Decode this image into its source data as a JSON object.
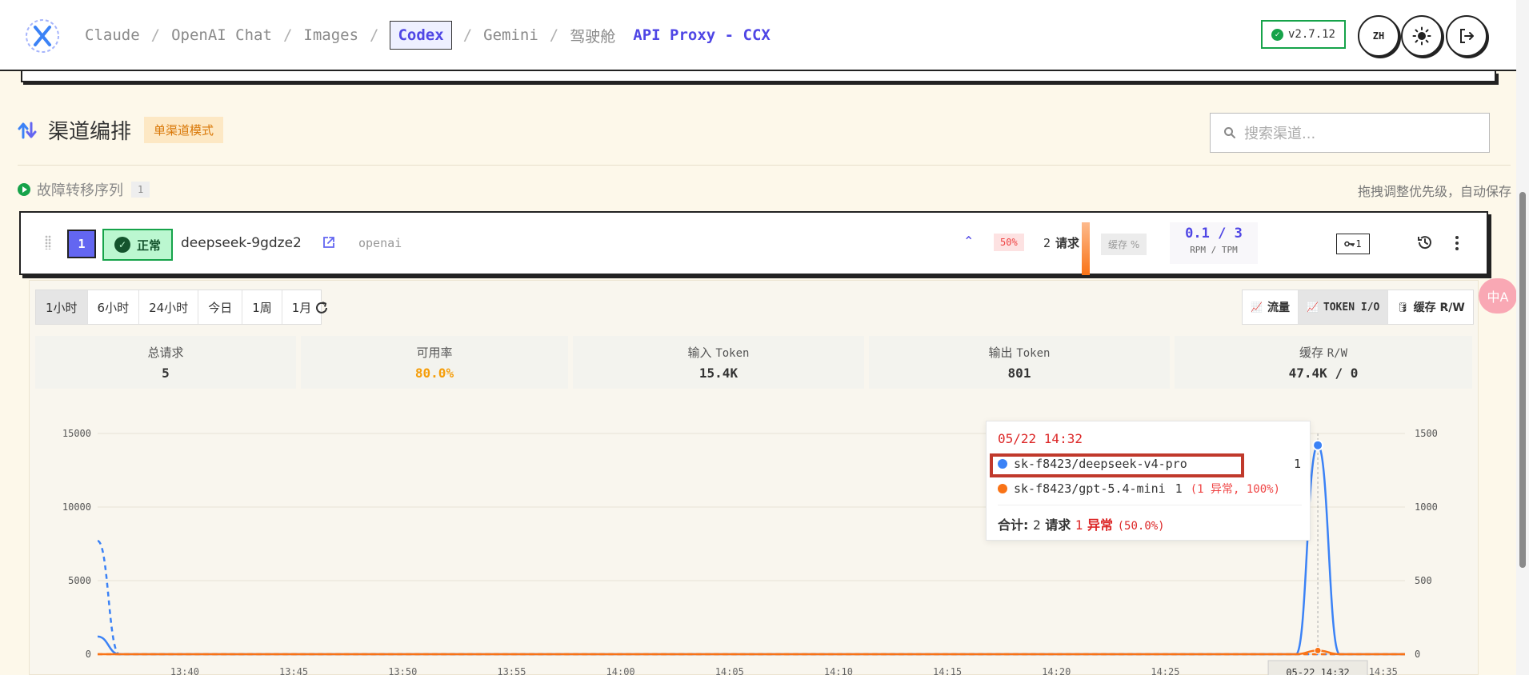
{
  "header": {
    "nav": [
      {
        "label": "Claude",
        "active": false
      },
      {
        "label": "OpenAI Chat",
        "active": false
      },
      {
        "label": "Images",
        "active": false
      },
      {
        "label": "Codex",
        "active": true
      },
      {
        "label": "Gemini",
        "active": false
      },
      {
        "label": "驾驶舱",
        "active": false
      }
    ],
    "brand": "API Proxy - CCX",
    "version": "v2.7.12",
    "lang": "ZH"
  },
  "section": {
    "title": "渠道编排",
    "mode_badge": "单渠道模式",
    "search_placeholder": "搜索渠道...",
    "failover_label": "故障转移序列",
    "failover_count": "1",
    "drag_hint": "拖拽调整优先级，自动保存"
  },
  "channel": {
    "index": "1",
    "status": "正常",
    "name": "deepseek-9gdze2",
    "type": "openai",
    "error_rate": "50%",
    "requests_count": "2",
    "requests_label": "请求",
    "cache_label": "缓存 %",
    "rate_value": "0.1 / 3",
    "rate_label": "RPM / TPM",
    "keys_count": "1"
  },
  "ranges": [
    {
      "label": "1小时",
      "active": true
    },
    {
      "label": "6小时",
      "active": false
    },
    {
      "label": "24小时",
      "active": false
    },
    {
      "label": "今日",
      "active": false
    },
    {
      "label": "1周",
      "active": false
    },
    {
      "label": "1月",
      "active": false
    }
  ],
  "metric_tabs": [
    {
      "label": "流量",
      "active": false
    },
    {
      "label": "TOKEN I/O",
      "active": true
    },
    {
      "label": "缓存 R/W",
      "active": false
    }
  ],
  "fab_label": "中A",
  "stats": {
    "total_requests": {
      "label": "总请求",
      "value": "5"
    },
    "availability": {
      "label": "可用率",
      "value": "80.0%"
    },
    "input_token": {
      "label": "输入",
      "label_mono": "Token",
      "value": "15.4K"
    },
    "output_token": {
      "label": "输出",
      "label_mono": "Token",
      "value": "801"
    },
    "cache_rw": {
      "label": "缓存",
      "label_mono": "R/W",
      "value": "47.4K / 0"
    }
  },
  "chart_data": {
    "type": "line",
    "x_ticks": [
      "13:40",
      "13:45",
      "13:50",
      "13:55",
      "14:00",
      "14:05",
      "14:10",
      "14:15",
      "14:20",
      "14:25",
      "14:35"
    ],
    "y_left_ticks": [
      "0",
      "5000",
      "10000",
      "15000"
    ],
    "y_right_ticks": [
      "0",
      "500",
      "1000",
      "1500"
    ],
    "ylim_left": [
      0,
      15000
    ],
    "ylim_right": [
      0,
      1500
    ],
    "x_start": "13:36",
    "x_end": "14:36",
    "crosshair_label": "05-22 14:32",
    "grid": true,
    "series": [
      {
        "color": "#3b82f6",
        "axis": "left",
        "style": "solid",
        "points": [
          [
            "13:36",
            1200
          ],
          [
            "13:37",
            0
          ],
          [
            "14:31",
            0
          ],
          [
            "14:32",
            14200
          ],
          [
            "14:33",
            0
          ],
          [
            "14:36",
            0
          ]
        ]
      },
      {
        "color": "#3b82f6",
        "axis": "right",
        "style": "dashed",
        "points": [
          [
            "13:36",
            770
          ],
          [
            "13:37",
            0
          ],
          [
            "14:36",
            0
          ]
        ]
      },
      {
        "color": "#f97316",
        "axis": "left",
        "style": "solid",
        "points": [
          [
            "13:36",
            0
          ],
          [
            "14:31",
            0
          ],
          [
            "14:32",
            250
          ],
          [
            "14:33",
            0
          ],
          [
            "14:36",
            0
          ]
        ]
      },
      {
        "color": "#f97316",
        "axis": "right",
        "style": "dashed",
        "points": [
          [
            "13:36",
            0
          ],
          [
            "14:36",
            0
          ]
        ]
      }
    ]
  },
  "tooltip": {
    "time": "05/22 14:32",
    "rows": [
      {
        "name": "sk-f8423/deepseek-v4-pro",
        "count": "1",
        "error": "",
        "color": "#3b82f6"
      },
      {
        "name": "sk-f8423/gpt-5.4-mini",
        "count": "1",
        "error": "(1 异常, 100%)",
        "color": "#f97316"
      }
    ],
    "total_label": "合计:",
    "total_count": "2",
    "total_req_label": "请求",
    "total_err_count": "1",
    "total_err_label": "异常",
    "total_err_pct": "(50.0%)"
  }
}
